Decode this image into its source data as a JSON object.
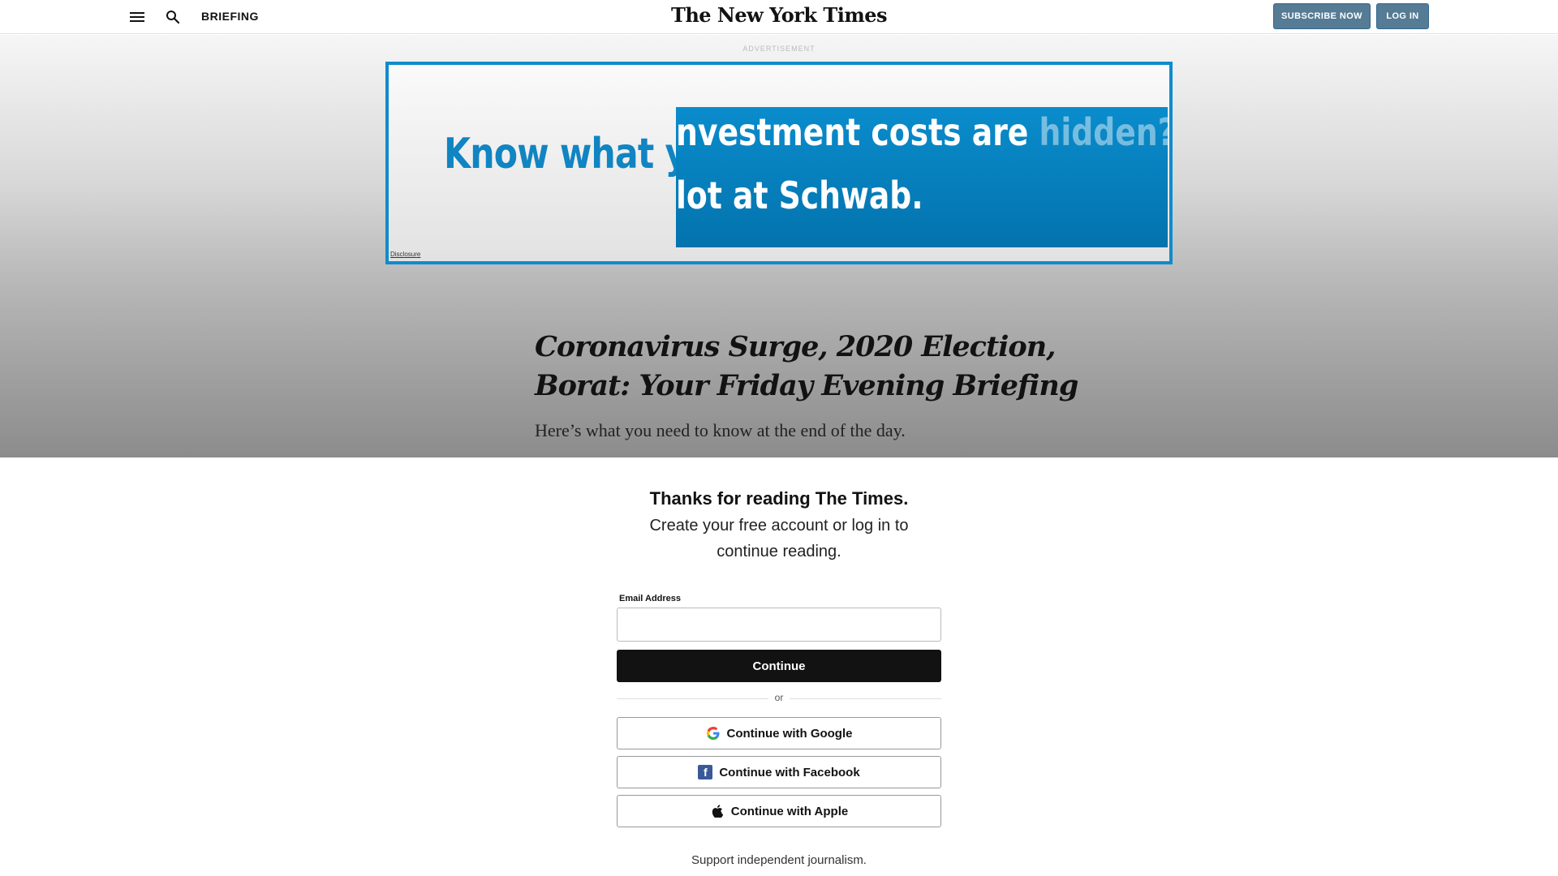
{
  "header": {
    "section": "BRIEFING",
    "masthead": "The New York Times",
    "subscribe_label": "SUBSCRIBE NOW",
    "login_label": "LOG IN"
  },
  "ad": {
    "label": "ADVERTISEMENT",
    "headline": "Know what y",
    "panel_line1": "nvestment costs are ",
    "panel_line1_faded": "hidden?",
    "panel_line2": "lot at Schwab.",
    "disclosure": "Disclosure"
  },
  "article": {
    "headline": "Coronavirus Surge, 2020 Election, Borat: Your Friday Evening Briefing",
    "dek": "Here’s what you need to know at the end of the day."
  },
  "regwall": {
    "title": "Thanks for reading The Times.",
    "subtitle": "Create your free account or log in to continue reading.",
    "email_label": "Email Address",
    "email_value": "",
    "continue_label": "Continue",
    "or_label": "or",
    "google_label": "Continue with Google",
    "facebook_label": "Continue with Facebook",
    "apple_label": "Continue with Apple",
    "support_text": "Support independent journalism."
  },
  "colors": {
    "button_blue": "#567b95",
    "ad_blue": "#1184c2",
    "facebook_blue": "#3b5998"
  }
}
